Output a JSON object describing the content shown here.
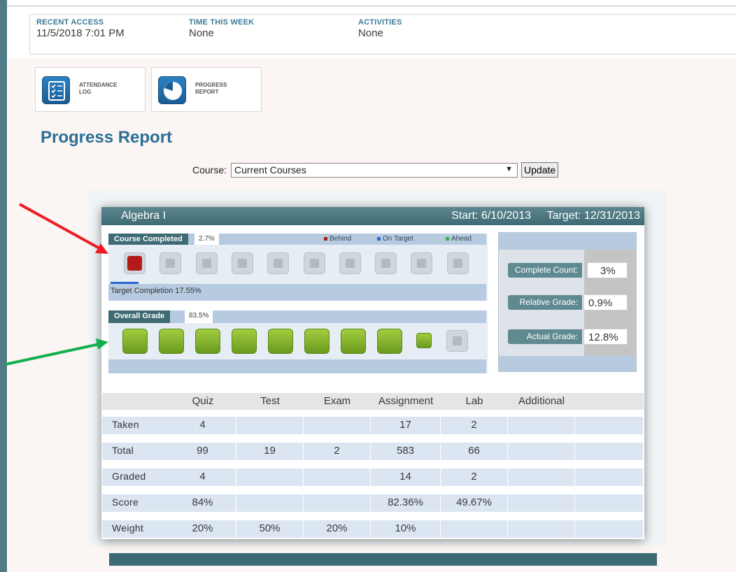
{
  "stats": [
    {
      "label": "RECENT ACCESS",
      "value": "11/5/2018 7:01 PM"
    },
    {
      "label": "TIME THIS WEEK",
      "value": "None"
    },
    {
      "label": "ACTIVITIES",
      "value": "None"
    }
  ],
  "tiles": {
    "attendance": {
      "line1": "ATTENDANCE",
      "line2": "LOG"
    },
    "progress": {
      "line1": "PROGRESS",
      "line2": "REPORT"
    }
  },
  "page_title": "Progress Report",
  "course_filter": {
    "label": "Course:",
    "selected": "Current Courses",
    "update_label": "Update"
  },
  "card": {
    "course_name": "Algebra I",
    "start": "Start: 6/10/2013",
    "target": "Target: 12/31/2013",
    "completed": {
      "label": "Course Completed",
      "percent_text": "2.7%",
      "legend": {
        "behind": "Behind",
        "on_target": "On Target",
        "ahead": "Ahead"
      },
      "target_completion_text": "Target Completion 17.55%",
      "target_completion": 0.1755,
      "boxes_filled": 1,
      "boxes_total": 10
    },
    "grade": {
      "label": "Overall Grade",
      "percent_text": "83.5%",
      "boxes_filled": 8,
      "boxes_partial": 1,
      "boxes_total": 10
    },
    "metrics": [
      {
        "label": "Complete Count:",
        "value": "3%"
      },
      {
        "label": "Relative Grade:",
        "value": "0.9%"
      },
      {
        "label": "Actual Grade:",
        "value": "12.8%"
      }
    ]
  },
  "table": {
    "columns": [
      "",
      "Quiz",
      "Test",
      "Exam",
      "Assignment",
      "Lab",
      "Additional",
      ""
    ],
    "rows": [
      {
        "label": "Taken",
        "cells": [
          "4",
          "",
          "",
          "17",
          "2",
          "",
          ""
        ]
      },
      {
        "label": "Total",
        "cells": [
          "99",
          "19",
          "2",
          "583",
          "66",
          "",
          ""
        ]
      },
      {
        "label": "Graded",
        "cells": [
          "4",
          "",
          "",
          "14",
          "2",
          "",
          ""
        ]
      },
      {
        "label": "Score",
        "cells": [
          "84%",
          "",
          "",
          "82.36%",
          "49.67%",
          "",
          ""
        ]
      },
      {
        "label": "Weight",
        "cells": [
          "20%",
          "50%",
          "20%",
          "10%",
          "",
          "",
          ""
        ]
      }
    ]
  },
  "colors": {
    "behind": "#b41a1a",
    "on_target": "#2a66d6",
    "ahead": "#3cae3c",
    "header": "#3e6a74",
    "title": "#2b6f95"
  }
}
